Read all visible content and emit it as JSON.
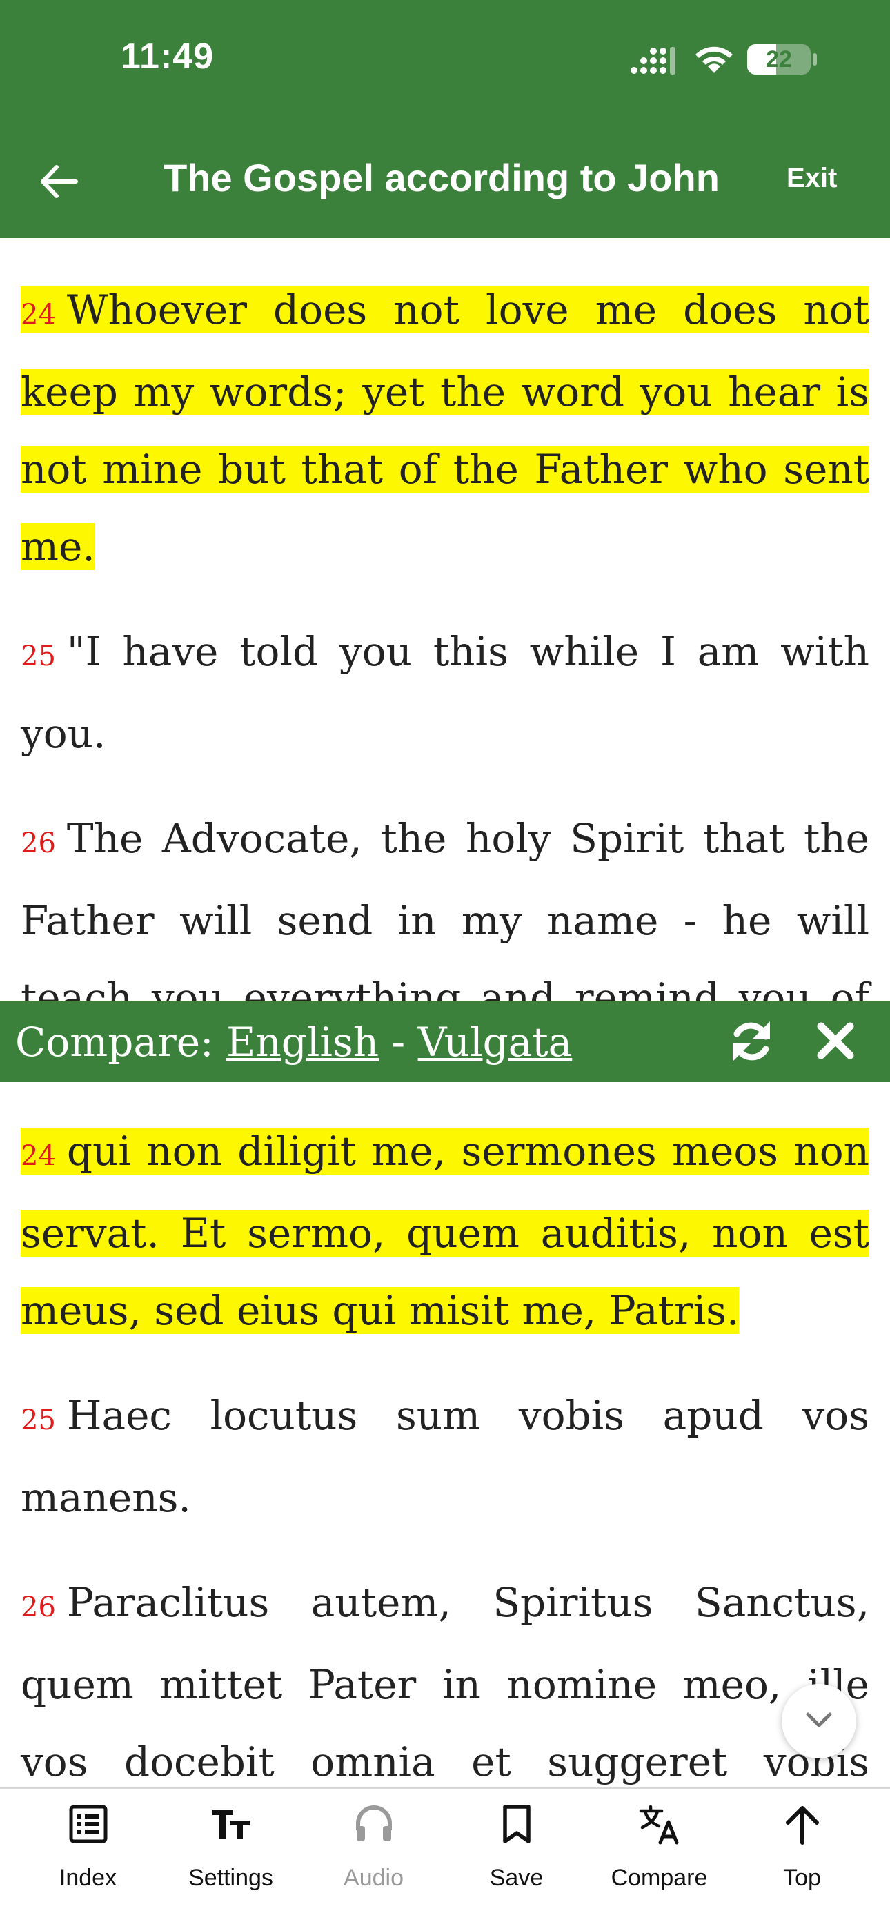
{
  "status_bar": {
    "time": "11:49",
    "battery": "22"
  },
  "header": {
    "title": "The Gospel according to John",
    "exit_label": "Exit",
    "back_icon": "arrow-left-icon"
  },
  "english": {
    "verses": [
      {
        "num": "24",
        "text": "Whoever does not love me does not keep my words; yet the word you hear is not mine but that of the Father who sent me.",
        "highlighted": true
      },
      {
        "num": "25",
        "text": "\"I have told you this while I am with you.",
        "highlighted": false
      },
      {
        "num": "26",
        "text": "The Advocate, the holy Spirit that the Father will send in my name - he will teach you everything and remind you of all that (I) told you.",
        "highlighted": false
      }
    ]
  },
  "compare_bar": {
    "prefix": "Compare: ",
    "left_version": "English",
    "separator": " - ",
    "right_version": "Vulgata"
  },
  "latin": {
    "verses": [
      {
        "num": "24",
        "text": "qui non diligit me, sermones meos non servat. Et sermo, quem auditis, non est meus, sed eius qui misit me, Patris.",
        "highlighted": true
      },
      {
        "num": "25",
        "text": "Haec locutus sum vobis apud vos manens.",
        "highlighted": false
      },
      {
        "num": "26",
        "text": "Paraclitus autem, Spiritus Sanctus, quem mittet Pater in nomine meo, ille vos docebit omnia et suggeret vobis omnia",
        "highlighted": false
      }
    ]
  },
  "bottom_nav": {
    "items": [
      {
        "label": "Index",
        "icon": "list-icon"
      },
      {
        "label": "Settings",
        "icon": "text-size-icon"
      },
      {
        "label": "Audio",
        "icon": "headphones-icon"
      },
      {
        "label": "Save",
        "icon": "bookmark-icon"
      },
      {
        "label": "Compare",
        "icon": "translate-icon"
      },
      {
        "label": "Top",
        "icon": "arrow-up-icon"
      }
    ]
  },
  "colors": {
    "header_green": "#3b803b",
    "highlight_yellow": "#fdf701",
    "verse_number_red": "#e01b1b"
  }
}
